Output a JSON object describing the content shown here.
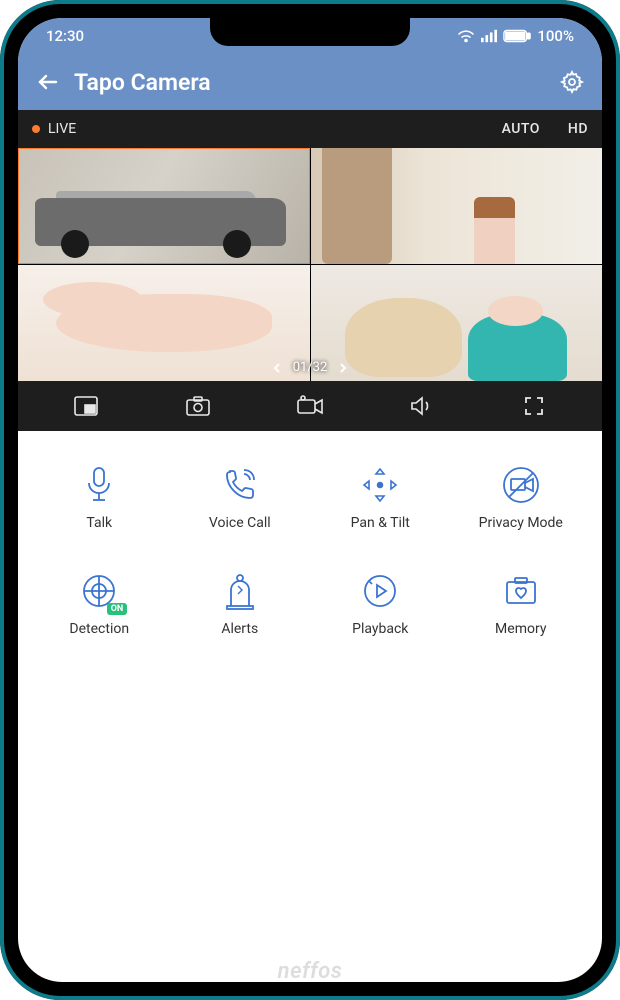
{
  "status": {
    "time": "12:30",
    "battery": "100%"
  },
  "appbar": {
    "title": "Tapo Camera"
  },
  "video": {
    "live": "LIVE",
    "auto": "AUTO",
    "hd": "HD",
    "pager": "01/32"
  },
  "features": {
    "talk": "Talk",
    "voice_call": "Voice Call",
    "pan_tilt": "Pan & Tilt",
    "privacy": "Privacy Mode",
    "detection": "Detection",
    "detection_badge": "ON",
    "alerts": "Alerts",
    "playback": "Playback",
    "memory": "Memory"
  },
  "brand": "neffos"
}
